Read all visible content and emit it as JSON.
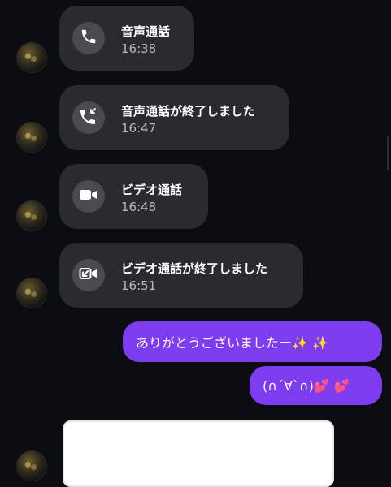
{
  "messages": [
    {
      "title": "音声通話",
      "time": "16:38",
      "icon": "phone-icon"
    },
    {
      "title": "音声通話が終了しました",
      "time": "16:47",
      "icon": "phone-ended-icon"
    },
    {
      "title": "ビデオ通話",
      "time": "16:48",
      "icon": "video-camera-icon"
    },
    {
      "title": "ビデオ通話が終了しました",
      "time": "16:51",
      "icon": "video-ended-icon"
    }
  ],
  "sent": [
    {
      "text": "ありがとうございましたー✨ ✨"
    },
    {
      "text": "(∩´∀`∩)💕 💕"
    }
  ],
  "colors": {
    "background": "#0b0d12",
    "incoming_bubble": "#2a2b30",
    "icon_circle": "#4a4b50",
    "sent_bubble": "#7e3cf0",
    "redacted": "#ffffff"
  }
}
